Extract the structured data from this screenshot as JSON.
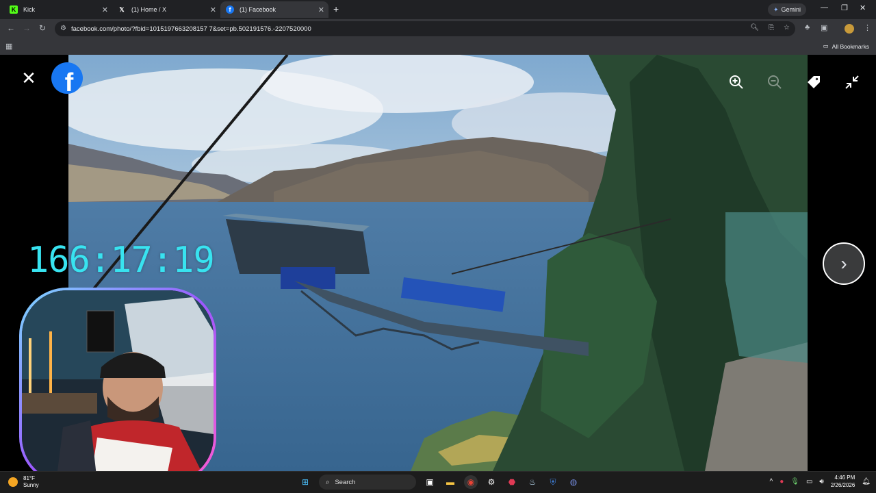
{
  "browser": {
    "tabs": [
      {
        "label": "Kick",
        "active": false
      },
      {
        "label": "(1) Home / X",
        "active": false
      },
      {
        "label": "(1) Facebook",
        "active": true
      }
    ],
    "gemini_label": "Gemini",
    "url": "facebook.com/photo/?fbid=1015197663208157 7&set=pb.502191576.-2207520000",
    "all_bookmarks": "All Bookmarks"
  },
  "overlay": {
    "timer": "166:17:19"
  },
  "taskbar": {
    "weather_temp": "81°F",
    "weather_desc": "Sunny",
    "search_label": "Search",
    "time": "4:46 PM",
    "date": "2/26/2026"
  },
  "colors": {
    "facebook_blue": "#1877f2",
    "timer_cyan": "#38e3f0"
  }
}
